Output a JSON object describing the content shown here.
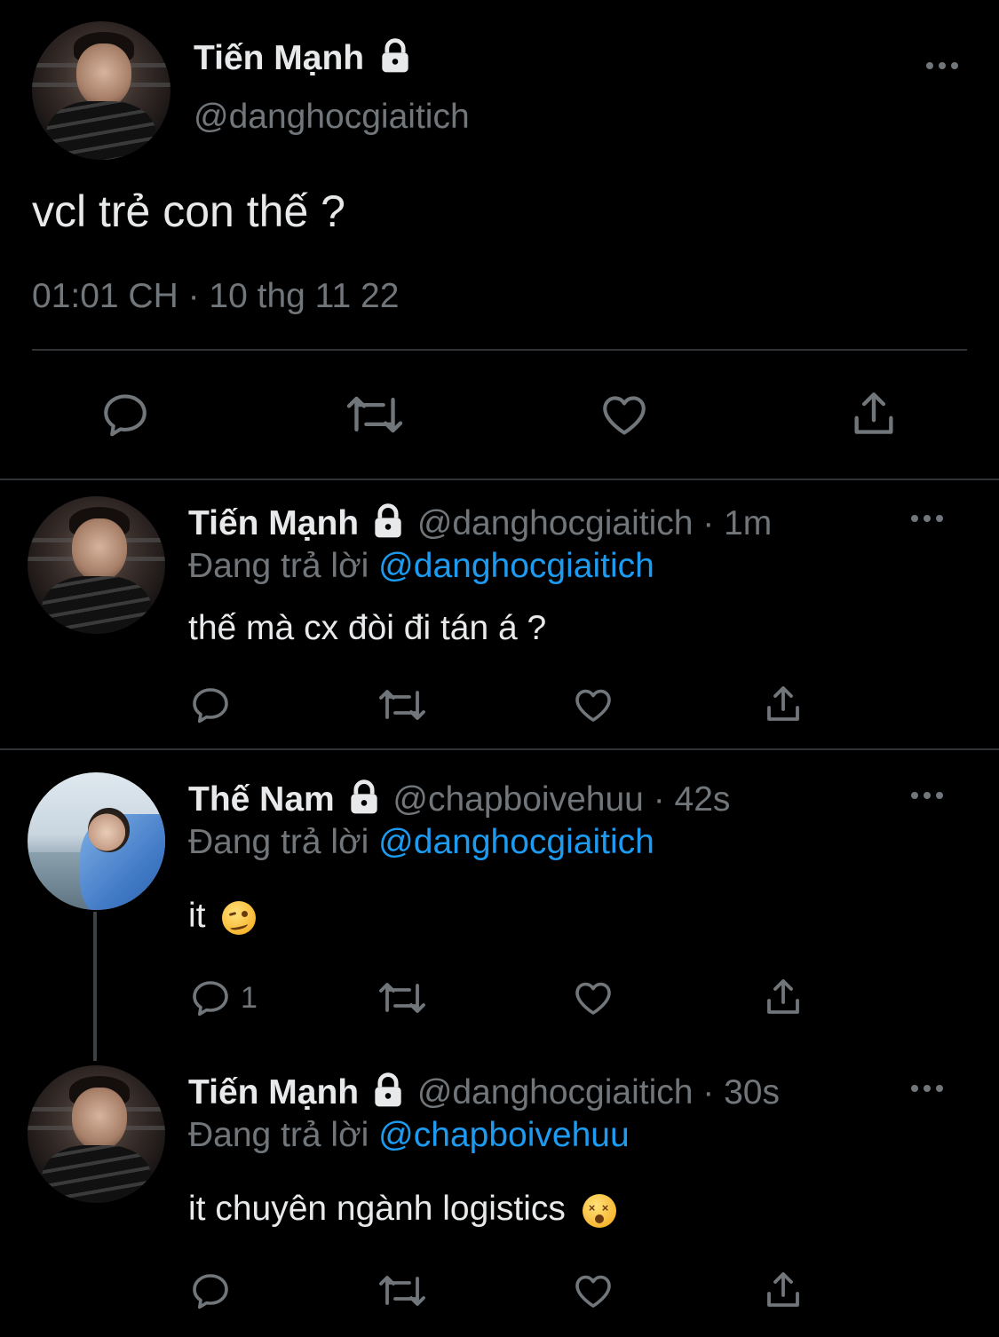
{
  "main_tweet": {
    "display_name": "Tiến Mạnh",
    "handle": "@danghocgiaitich",
    "text": "vcl trẻ con thế ?",
    "timestamp": "01:01 CH · 10 thg 11 22",
    "avatar_icon": "avatar-photo-dark",
    "locked": true
  },
  "replies": [
    {
      "display_name": "Tiến Mạnh",
      "handle": "@danghocgiaitich",
      "time": "· 1m",
      "replying_prefix": "Đang trả lời",
      "replying_to": "@danghocgiaitich",
      "text": "thế mà cx đòi đi tán á ?",
      "reply_count": ""
    },
    {
      "display_name": "Thế Nam",
      "handle": "@chapboivehuu",
      "time": "· 42s",
      "replying_prefix": "Đang trả lời",
      "replying_to": "@danghocgiaitich",
      "text": "it",
      "emoji": "woozy-face-emoji",
      "reply_count": "1"
    },
    {
      "display_name": "Tiến Mạnh",
      "handle": "@danghocgiaitich",
      "time": "· 30s",
      "replying_prefix": "Đang trả lời",
      "replying_to": "@chapboivehuu",
      "text": "it chuyên ngành logistics",
      "emoji": "dizzy-face-emoji",
      "reply_count": ""
    }
  ],
  "colors": {
    "background": "#000000",
    "text": "#e7e9ea",
    "muted": "#71767b",
    "link": "#1d9bf0",
    "divider": "#2f3336"
  }
}
